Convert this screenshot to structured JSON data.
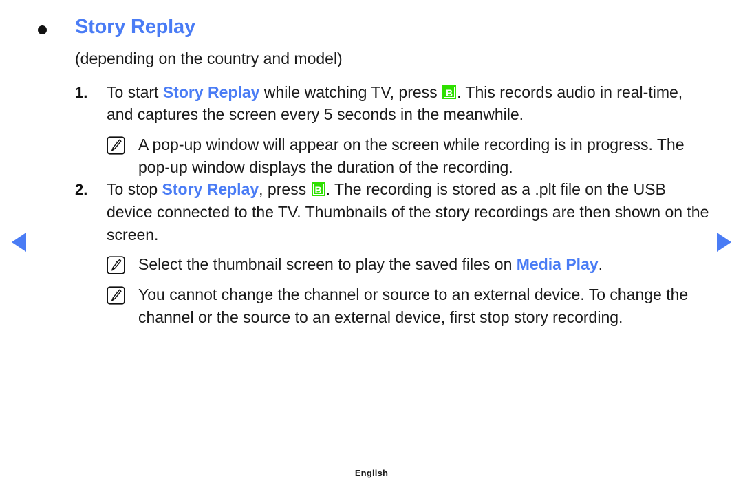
{
  "nav": {
    "prev_label": "previous page",
    "next_label": "next page"
  },
  "heading": {
    "bullet": "•",
    "title": "Story Replay"
  },
  "subnote": "(depending on the country and model)",
  "key_badge": {
    "letter": "B",
    "color": "#2ee000",
    "text_color": "#ffffff"
  },
  "colors": {
    "link_blue": "#4a7cf5",
    "body_text": "#1a1a1a",
    "bullet": "#111111"
  },
  "steps": [
    {
      "number": "1.",
      "parts": [
        {
          "type": "text",
          "value": "To start "
        },
        {
          "type": "highlight",
          "value": "Story Replay"
        },
        {
          "type": "text",
          "value": " while watching TV, press "
        },
        {
          "type": "key",
          "value": "B"
        },
        {
          "type": "text",
          "value": ". This records audio in real-time, and captures the screen every 5 seconds in the meanwhile."
        }
      ],
      "notes": [
        {
          "icon": "note-pencil-icon",
          "parts": [
            {
              "type": "text",
              "value": "A pop-up window will appear on the screen while recording is in progress. The pop-up window displays the duration of the recording."
            }
          ]
        }
      ]
    },
    {
      "number": "2.",
      "parts": [
        {
          "type": "text",
          "value": "To stop "
        },
        {
          "type": "highlight",
          "value": "Story Replay"
        },
        {
          "type": "text",
          "value": ", press "
        },
        {
          "type": "key",
          "value": "B"
        },
        {
          "type": "text",
          "value": ". The recording is stored as a .plt file on the USB device connected to the TV. Thumbnails of the story recordings are then shown on the screen."
        }
      ],
      "notes": [
        {
          "icon": "note-pencil-icon",
          "parts": [
            {
              "type": "text",
              "value": "Select the thumbnail screen to play the saved files on "
            },
            {
              "type": "highlight",
              "value": "Media Play"
            },
            {
              "type": "text",
              "value": "."
            }
          ]
        },
        {
          "icon": "note-pencil-icon",
          "parts": [
            {
              "type": "text",
              "value": "You cannot change the channel or source to an external device. To change the channel or the source to an external device, first stop story recording."
            }
          ]
        }
      ]
    }
  ],
  "footer": {
    "language": "English"
  }
}
